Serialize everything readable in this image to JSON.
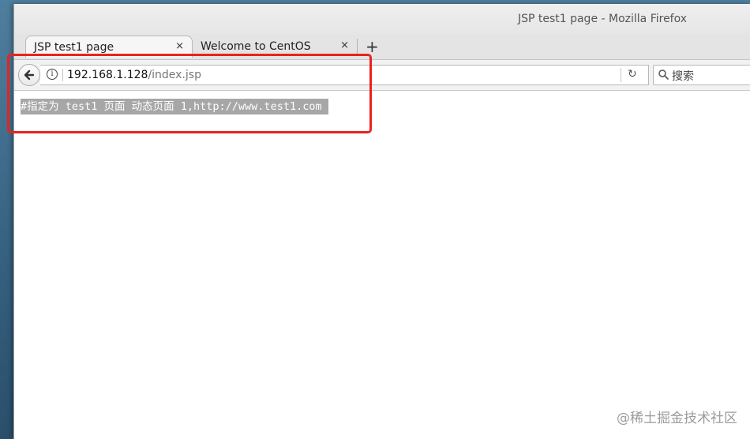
{
  "window": {
    "title": "JSP test1 page - Mozilla Firefox"
  },
  "tabs": [
    {
      "label": "JSP test1 page",
      "close": "×",
      "active": true
    },
    {
      "label": "Welcome to CentOS",
      "close": "×",
      "active": false
    }
  ],
  "new_tab": "+",
  "navbar": {
    "back_icon": "arrow-left-icon",
    "info": "i",
    "url_host": "192.168.1.128",
    "url_path": "/index.jsp",
    "reload": "↻",
    "search_placeholder": "搜索"
  },
  "page": {
    "selected_text": "#指定为 test1 页面 动态页面 1,http://www.test1.com"
  },
  "annotation": {
    "color": "#e8231f"
  },
  "watermark": "@稀土掘金技术社区"
}
